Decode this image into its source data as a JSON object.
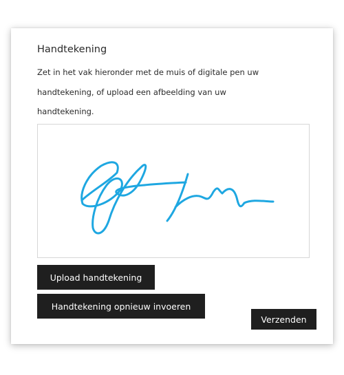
{
  "form": {
    "title": "Handtekening",
    "instructions": [
      "Zet in het vak hieronder met de muis of digitale pen uw",
      "handtekening, of upload een afbeelding van uw",
      "handtekening."
    ],
    "signature_stroke_color": "#1ea7e1",
    "buttons": {
      "upload": "Upload handtekening",
      "redo": "Handtekening opnieuw invoeren",
      "submit": "Verzenden"
    }
  }
}
